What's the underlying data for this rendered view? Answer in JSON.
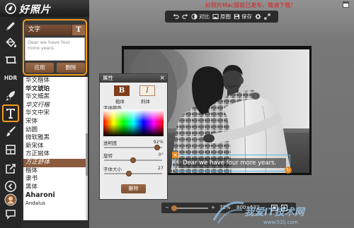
{
  "app": {
    "name": "好照片",
    "notice": "好照片Mac版就已发布，敬请下载！",
    "notice_icon": "window-icon"
  },
  "tools": [
    {
      "icon": "pencil-icon"
    },
    {
      "icon": "paint-bucket-icon"
    },
    {
      "icon": "crop-icon"
    },
    {
      "icon": "hdr-icon",
      "label": "HDR"
    },
    {
      "icon": "rocket-icon"
    },
    {
      "icon": "text-tool-icon",
      "selected": true
    },
    {
      "icon": "brush-icon"
    },
    {
      "icon": "frame-icon"
    },
    {
      "icon": "export-icon"
    },
    {
      "icon": "back-icon"
    },
    {
      "icon": "avatar-icon"
    },
    {
      "icon": "chat-icon"
    }
  ],
  "text_panel": {
    "title": "文字",
    "title_button": "T",
    "placeholder": "Dear we have four more years.",
    "apply_label": "应用",
    "delete_label": "删除"
  },
  "fonts": {
    "items": [
      "华文楷体",
      "华文琥珀",
      "华文细黑",
      "华文行楷",
      "华文中宋",
      "宋体",
      "幼圆",
      "微软雅黑",
      "新宋体",
      "方正姚体",
      "方正舒体",
      "楷体",
      "隶书",
      "黑体",
      "Aharoni",
      "Andalus"
    ],
    "selected_index": 10
  },
  "toolbar": {
    "contrast_label": "对比",
    "original_label": "原图",
    "save_label": "保存",
    "icons": [
      "undo-icon",
      "redo-icon",
      "contrast-icon",
      "original-icon",
      "save-icon",
      "gear-icon",
      "expand-icon"
    ]
  },
  "canvas": {
    "overlay_text": "Dear we have four more years."
  },
  "properties": {
    "title": "属性",
    "close_label": "×",
    "bold_label": "B",
    "italic_label": "I",
    "bold_caption": "粗体",
    "italic_caption": "斜体",
    "color_label": "字体颜色",
    "opacity_label": "透明度",
    "opacity_value": "92%",
    "opacity": 92,
    "rotation_label": "旋转",
    "rotation_value": "0°",
    "rotation": 0,
    "size_label": "字体大小",
    "size_value": "27",
    "size": 27,
    "delete_label": "删除"
  },
  "zoom": {
    "minus_label": "−",
    "plus_label": "+",
    "value_text": "72%",
    "zoom": 72,
    "dimensions": "800×532"
  },
  "watermark": {
    "title": "我爱IT技术网",
    "url": "www.52ij.com"
  },
  "colors": {
    "accent": "#f29c1f",
    "brown": "#8b5a3c",
    "notice": "#e01e1e",
    "selection": "#5ab4e5"
  }
}
